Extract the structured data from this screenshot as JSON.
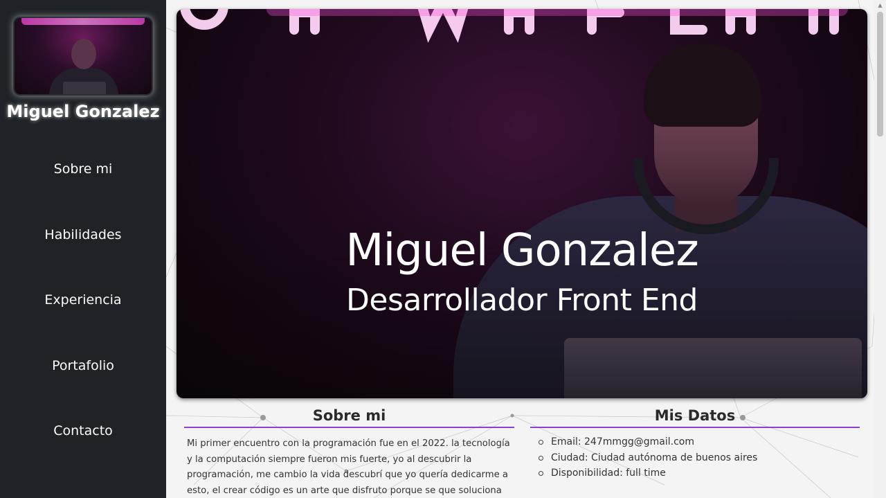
{
  "sidebar": {
    "name": "Miguel Gonzalez",
    "nav": [
      {
        "label": "Sobre mi"
      },
      {
        "label": "Habilidades"
      },
      {
        "label": "Experiencia"
      },
      {
        "label": "Portafolio"
      },
      {
        "label": "Contacto"
      }
    ]
  },
  "hero": {
    "title": "Miguel Gonzalez",
    "subtitle": "Desarrollador Front End"
  },
  "about": {
    "heading": "Sobre mi",
    "text": "Mi primer encuentro con la programación fue en el 2022. la tecnología y la computación siempre fueron mis fuerte, yo al descubrir la programación, me cambio la vida descubrí que yo quería dedicarme a esto, el crear código es un arte que disfruto porque se que soluciona el problema de"
  },
  "datos": {
    "heading": "Mis Datos",
    "items": [
      {
        "text": "Email: 247mmgg@gmail.com"
      },
      {
        "text": "Ciudad: Ciudad autónoma de buenos aires"
      },
      {
        "text": "Disponibilidad: full time"
      }
    ]
  },
  "colors": {
    "sidebar_bg": "#1f2226",
    "accent_underline": "#8b3fd6"
  }
}
